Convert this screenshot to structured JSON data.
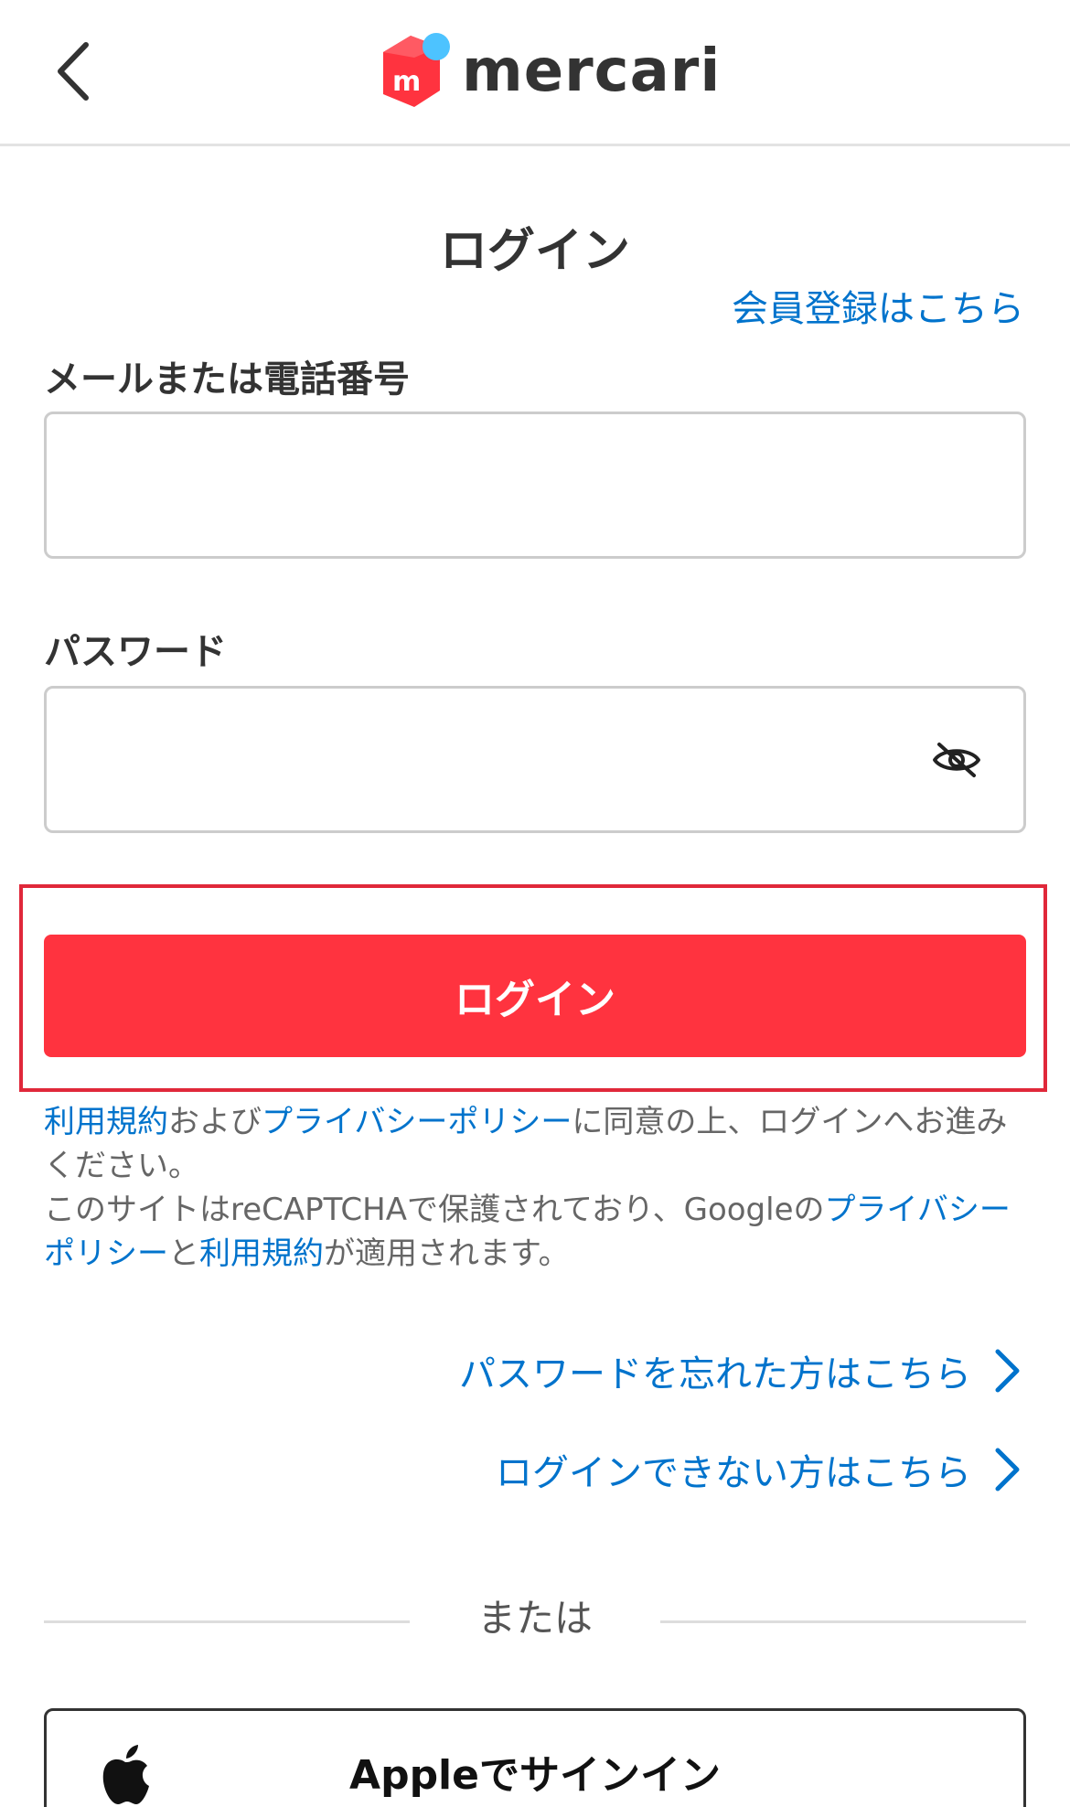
{
  "header": {
    "back_icon": "chevron-left-icon",
    "logo_text": "mercari",
    "brand_colors": {
      "red": "#ff333f",
      "blue": "#4dc3ff"
    }
  },
  "login_form": {
    "title": "ログイン",
    "signup_link": "会員登録はこちら",
    "email_label": "メールまたは電話番号",
    "email_value": "",
    "password_label": "パスワード",
    "password_value": "",
    "password_toggle_icon": "eye-off-icon",
    "submit_label": "ログイン"
  },
  "terms": {
    "terms_link": "利用規約",
    "and_text": "および",
    "privacy_link": "プライバシーポリシー",
    "agree_text": "に同意の上、ログインへお進みください。",
    "recaptcha_text": "このサイトはreCAPTCHAで保護されており、Googleの",
    "google_privacy_link": "プライバシーポリシー",
    "and2_text": "と",
    "google_terms_link": "利用規約",
    "applies_text": "が適用されます。"
  },
  "help_links": {
    "forgot_password": "パスワードを忘れた方はこちら",
    "cannot_login": "ログインできない方はこちら"
  },
  "divider": {
    "text": "または"
  },
  "apple_signin": {
    "label": "Appleでサインイン",
    "icon": "apple-logo-icon"
  },
  "colors": {
    "accent_red": "#ff333f",
    "link_blue": "#0073cc",
    "highlight_outline": "#e0283a"
  }
}
